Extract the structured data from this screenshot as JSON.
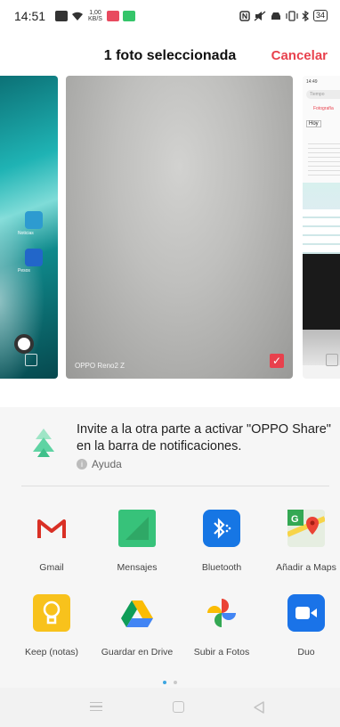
{
  "status_bar": {
    "time": "14:51",
    "speed": "1,00 KB/S",
    "battery": "34"
  },
  "header": {
    "title": "1 foto seleccionada",
    "cancel_label": "Cancelar"
  },
  "gallery": {
    "left_labels": [
      "Noticias",
      "Pesos"
    ],
    "main_watermark": "OPPO Reno2 Z",
    "right": {
      "time": "14:49",
      "search": "Tiempo",
      "tab": "Fotografía",
      "section": "Hoy"
    }
  },
  "share": {
    "invite_text": "Invite a la otra parte a activar \"OPPO Share\" en la barra de notificaciones.",
    "help_label": "Ayuda",
    "apps": [
      {
        "label": "Gmail",
        "icon": "gmail-icon"
      },
      {
        "label": "Mensajes",
        "icon": "messages-icon"
      },
      {
        "label": "Bluetooth",
        "icon": "bluetooth-icon"
      },
      {
        "label": "Añadir a Maps",
        "icon": "maps-icon"
      },
      {
        "label": "Keep (notas)",
        "icon": "keep-icon"
      },
      {
        "label": "Guardar en Drive",
        "icon": "drive-icon"
      },
      {
        "label": "Subir a Fotos",
        "icon": "photos-icon"
      },
      {
        "label": "Duo",
        "icon": "duo-icon"
      }
    ]
  },
  "colors": {
    "accent": "#e8414d",
    "sheet_bg": "#f6f6f6"
  }
}
